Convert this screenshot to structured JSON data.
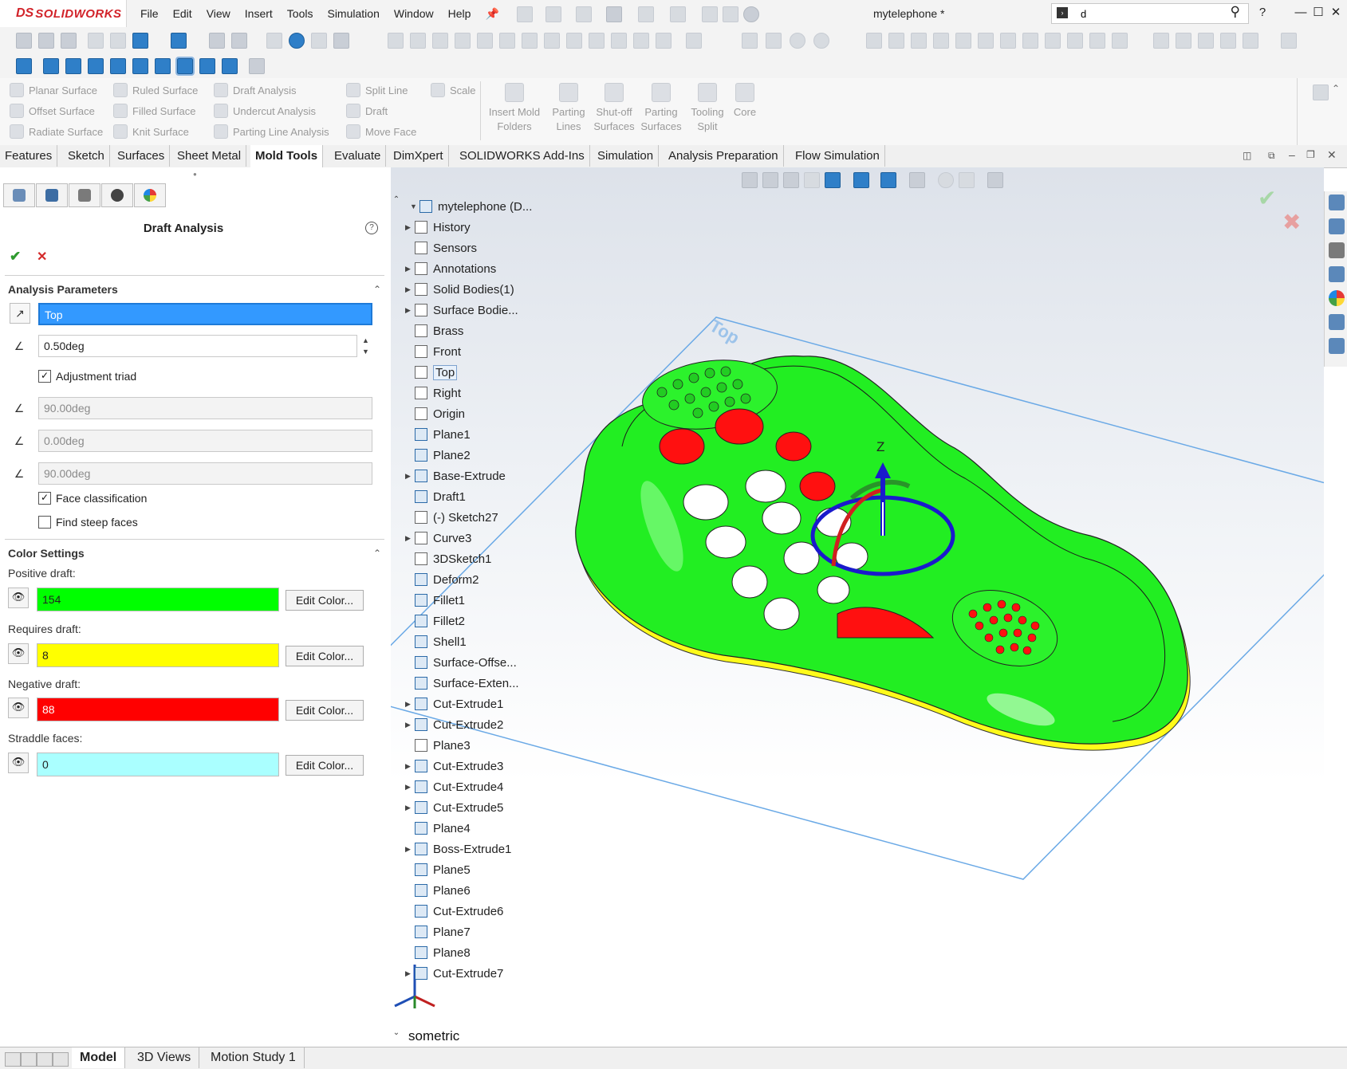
{
  "app": {
    "brand_ds": "DS",
    "brand_name": "SOLIDWORKS",
    "document_title": "mytelephone *",
    "search_value": "d"
  },
  "menus": [
    "File",
    "Edit",
    "View",
    "Insert",
    "Tools",
    "Simulation",
    "Window",
    "Help"
  ],
  "command_manager": {
    "small_items": [
      "Planar Surface",
      "Offset Surface",
      "Radiate Surface",
      "Ruled Surface",
      "Filled Surface",
      "Knit Surface",
      "Draft Analysis",
      "Undercut Analysis",
      "Parting Line Analysis",
      "Split Line",
      "Draft",
      "Move Face",
      "Scale"
    ],
    "large_items": [
      {
        "l1": "Insert Mold",
        "l2": "Folders"
      },
      {
        "l1": "Parting",
        "l2": "Lines"
      },
      {
        "l1": "Shut-off",
        "l2": "Surfaces"
      },
      {
        "l1": "Parting",
        "l2": "Surfaces"
      },
      {
        "l1": "Tooling",
        "l2": "Split"
      },
      {
        "l1": "Core",
        "l2": ""
      }
    ]
  },
  "tabs": [
    "Features",
    "Sketch",
    "Surfaces",
    "Sheet Metal",
    "Mold Tools",
    "Evaluate",
    "DimXpert",
    "SOLIDWORKS Add-Ins",
    "Simulation",
    "Analysis Preparation",
    "Flow Simulation"
  ],
  "active_tab": "Mold Tools",
  "property_manager": {
    "title": "Draft Analysis",
    "help": "?",
    "ok_symbol": "✔",
    "cancel_symbol": "✕",
    "analysis_parameters": {
      "header": "Analysis Parameters",
      "direction_value": "Top",
      "draft_angle": "0.50deg",
      "adjustment_triad_label": "Adjustment triad",
      "adjustment_triad_checked": true,
      "angle_x": "90.00deg",
      "angle_y": "0.00deg",
      "angle_z": "90.00deg",
      "face_classification_label": "Face classification",
      "face_classification_checked": true,
      "find_steep_faces_label": "Find steep faces",
      "find_steep_faces_checked": false
    },
    "color_settings": {
      "header": "Color Settings",
      "edit_label": "Edit Color...",
      "items": [
        {
          "label": "Positive draft:",
          "count": "154",
          "color": "#00ff00"
        },
        {
          "label": "Requires draft:",
          "count": "8",
          "color": "#ffff00"
        },
        {
          "label": "Negative draft:",
          "count": "88",
          "color": "#ff0000"
        },
        {
          "label": "Straddle faces:",
          "count": "0",
          "color": "#aaffff"
        }
      ]
    }
  },
  "feature_tree": {
    "root": "mytelephone  (D...",
    "items": [
      {
        "label": "History",
        "expand": true,
        "icon": "folder"
      },
      {
        "label": "Sensors",
        "expand": false,
        "icon": "sensor"
      },
      {
        "label": "Annotations",
        "expand": true,
        "icon": "annotation"
      },
      {
        "label": "Solid Bodies(1)",
        "expand": true,
        "icon": "folder"
      },
      {
        "label": "Surface Bodie...",
        "expand": true,
        "icon": "folder"
      },
      {
        "label": "Brass",
        "expand": false,
        "icon": "material"
      },
      {
        "label": "Front",
        "expand": false,
        "icon": "plane"
      },
      {
        "label": "Top",
        "expand": false,
        "icon": "plane",
        "highlight": true
      },
      {
        "label": "Right",
        "expand": false,
        "icon": "plane"
      },
      {
        "label": "Origin",
        "expand": false,
        "icon": "origin"
      },
      {
        "label": "Plane1",
        "expand": false,
        "icon": "refplane"
      },
      {
        "label": "Plane2",
        "expand": false,
        "icon": "refplane"
      },
      {
        "label": "Base-Extrude",
        "expand": true,
        "icon": "feature"
      },
      {
        "label": "Draft1",
        "expand": false,
        "icon": "feature"
      },
      {
        "label": "(-) Sketch27",
        "expand": false,
        "icon": "sketch"
      },
      {
        "label": "Curve3",
        "expand": true,
        "icon": "sketch"
      },
      {
        "label": "3DSketch1",
        "expand": false,
        "icon": "sketch"
      },
      {
        "label": "Deform2",
        "expand": false,
        "icon": "feature"
      },
      {
        "label": "Fillet1",
        "expand": false,
        "icon": "feature"
      },
      {
        "label": "Fillet2",
        "expand": false,
        "icon": "feature"
      },
      {
        "label": "Shell1",
        "expand": false,
        "icon": "feature"
      },
      {
        "label": "Surface-Offse...",
        "expand": false,
        "icon": "surface"
      },
      {
        "label": "Surface-Exten...",
        "expand": false,
        "icon": "surface"
      },
      {
        "label": "Cut-Extrude1",
        "expand": true,
        "icon": "feature"
      },
      {
        "label": "Cut-Extrude2",
        "expand": true,
        "icon": "feature"
      },
      {
        "label": "Plane3",
        "expand": false,
        "icon": "plane"
      },
      {
        "label": "Cut-Extrude3",
        "expand": true,
        "icon": "feature"
      },
      {
        "label": "Cut-Extrude4",
        "expand": true,
        "icon": "feature"
      },
      {
        "label": "Cut-Extrude5",
        "expand": true,
        "icon": "feature"
      },
      {
        "label": "Plane4",
        "expand": false,
        "icon": "refplane"
      },
      {
        "label": "Boss-Extrude1",
        "expand": true,
        "icon": "feature"
      },
      {
        "label": "Plane5",
        "expand": false,
        "icon": "refplane"
      },
      {
        "label": "Plane6",
        "expand": false,
        "icon": "refplane"
      },
      {
        "label": "Cut-Extrude6",
        "expand": false,
        "icon": "feature"
      },
      {
        "label": "Plane7",
        "expand": false,
        "icon": "refplane"
      },
      {
        "label": "Plane8",
        "expand": false,
        "icon": "refplane"
      },
      {
        "label": "Cut-Extrude7",
        "expand": true,
        "icon": "feature"
      }
    ]
  },
  "viewport": {
    "plane_label": "Top",
    "triad_axis": "Z",
    "view_orientation": "sometric"
  },
  "bottom_tabs": [
    "Model",
    "3D Views",
    "Motion Study 1"
  ],
  "active_bottom_tab": "Model"
}
